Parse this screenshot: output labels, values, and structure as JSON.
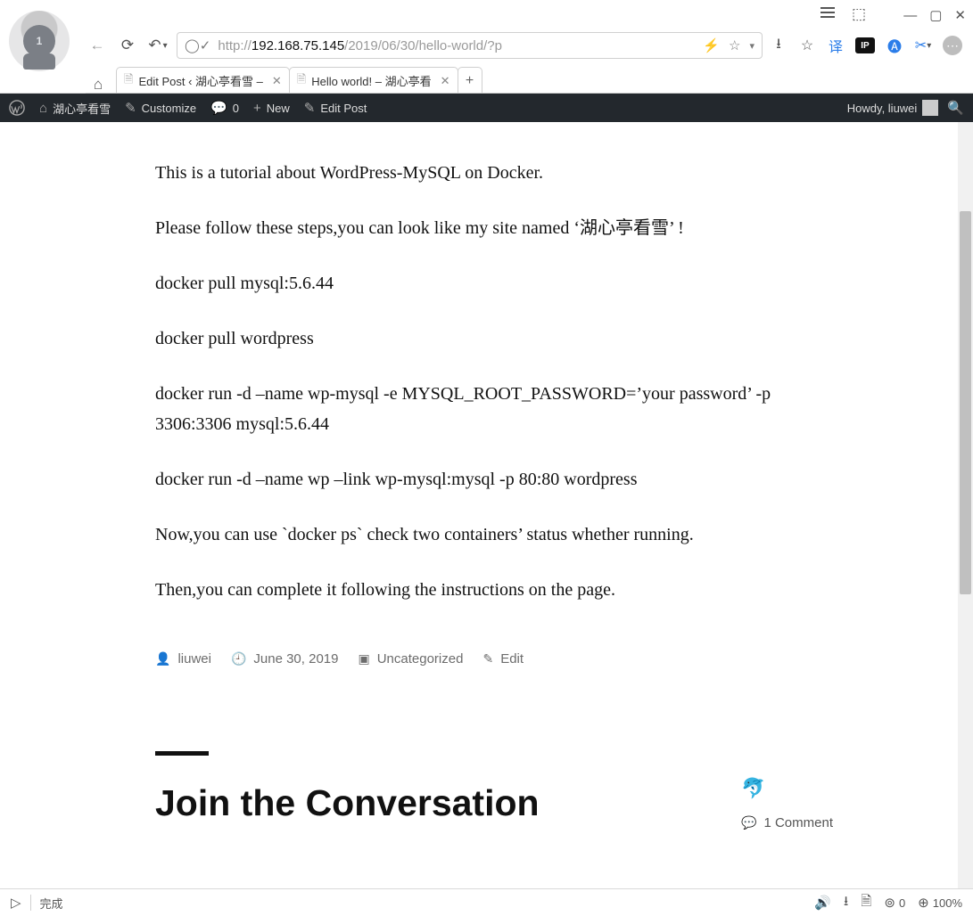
{
  "browser": {
    "url_prefix": "http://",
    "url_host": "192.168.75.145",
    "url_path": "/2019/06/30/hello-world/?p",
    "tabs": [
      {
        "title": "Edit Post ‹ 湖心亭看雪 –",
        "active": false
      },
      {
        "title": "Hello world! – 湖心亭看",
        "active": true
      }
    ]
  },
  "admin_bar": {
    "site_name": "湖心亭看雪",
    "customize": "Customize",
    "comments_count": "0",
    "new_label": "New",
    "edit_label": "Edit Post",
    "howdy": "Howdy, liuwei"
  },
  "post": {
    "paragraphs": [
      "This is a tutorial about WordPress-MySQL on Docker.",
      "Please follow these steps,you can look like my site named ‘湖心亭看雪’ !",
      "docker pull mysql:5.6.44",
      "docker pull wordpress",
      "docker run -d –name wp-mysql -e MYSQL_ROOT_PASSWORD=’your password’ -p 3306:3306 mysql:5.6.44",
      "docker run -d –name wp –link wp-mysql:mysql -p 80:80 wordpress",
      "Now,you can use `docker ps` check two containers’ status whether running.",
      "Then,you can complete it following the instructions on the page."
    ],
    "meta": {
      "author": "liuwei",
      "date": "June 30, 2019",
      "category": "Uncategorized",
      "edit": "Edit"
    },
    "conversation": {
      "heading": "Join the Conversation",
      "comment_text": "1 Comment"
    }
  },
  "status": {
    "left_text": "完成",
    "download_count": "0",
    "zoom": "100%"
  }
}
